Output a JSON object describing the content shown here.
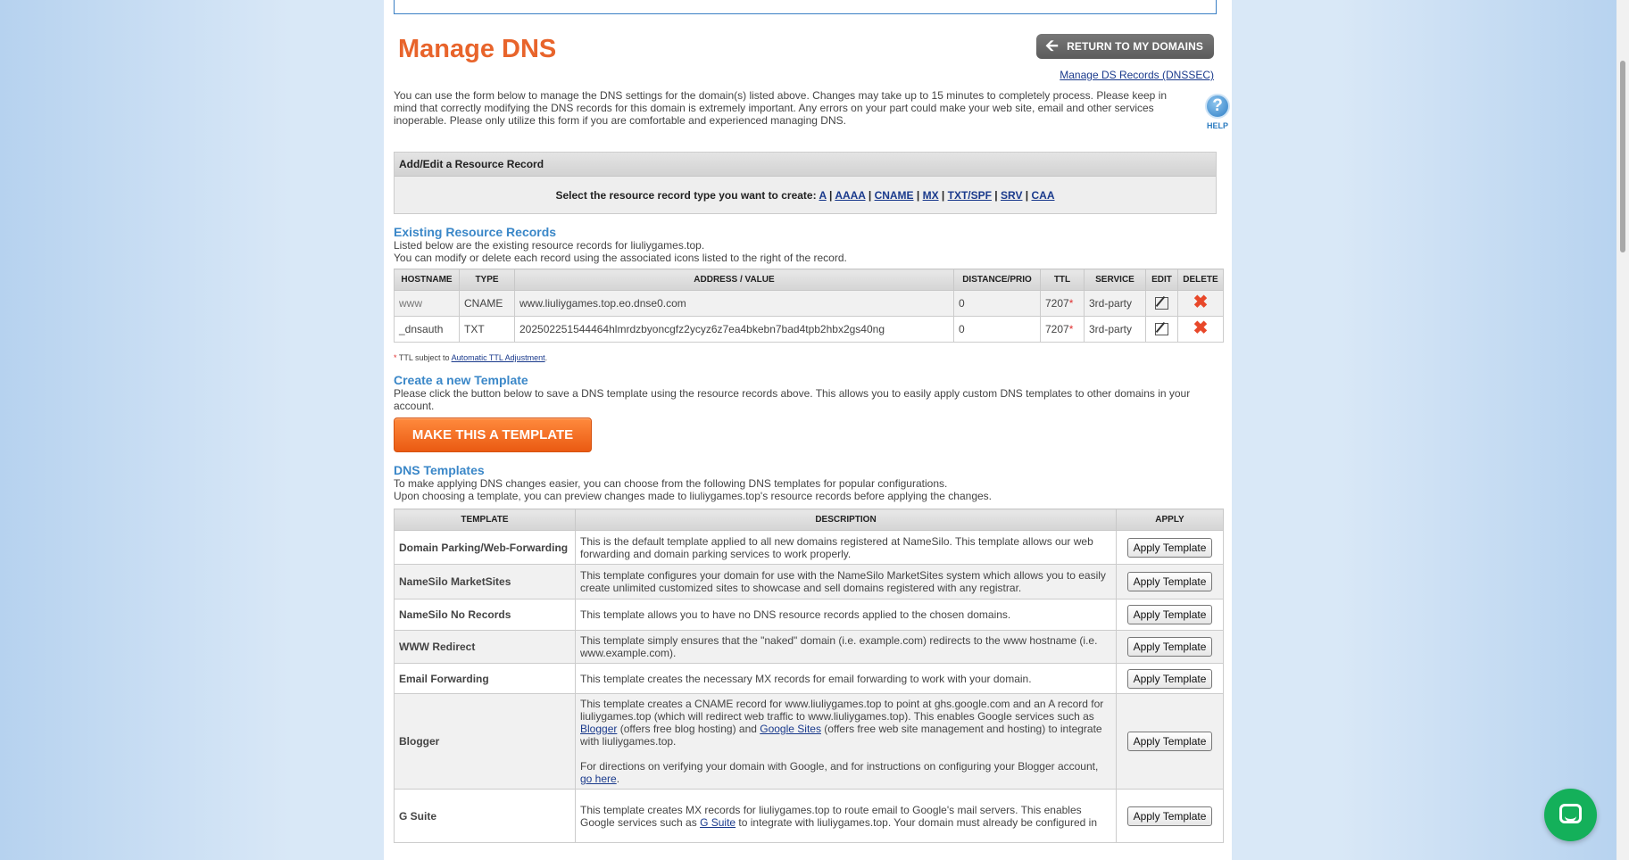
{
  "header": {
    "title": "Manage DNS",
    "return_label": "RETURN TO MY DOMAINS",
    "dnssec_link": "Manage DS Records (DNSSEC)",
    "help_label": "HELP",
    "help_glyph": "?"
  },
  "intro": "You can use the form below to manage the DNS settings for the domain(s) listed above. Changes may take up to 15 minutes to completely process. Please keep in mind that correctly modifying the DNS records for this domain is extremely important. Any errors on your part could make your web site, email and other services inoperable. Please only utilize this form if you are comfortable and experienced managing DNS.",
  "add_record": {
    "heading": "Add/Edit a Resource Record",
    "prompt": "Select the resource record type you want to create:",
    "types": [
      "A",
      "AAAA",
      "CNAME",
      "MX",
      "TXT/SPF",
      "SRV",
      "CAA"
    ]
  },
  "existing": {
    "heading": "Existing Resource Records",
    "line1": "Listed below are the existing resource records for liuliygames.top.",
    "line2": "You can modify or delete each record using the associated icons listed to the right of the record.",
    "columns": [
      "HOSTNAME",
      "TYPE",
      "ADDRESS / VALUE",
      "DISTANCE/PRIO",
      "TTL",
      "SERVICE",
      "EDIT",
      "DELETE"
    ],
    "rows": [
      {
        "hostname": "www",
        "type": "CNAME",
        "value": "www.liuliygames.top.eo.dnse0.com",
        "prio": "0",
        "ttl": "7207",
        "service": "3rd-party"
      },
      {
        "hostname": "_dnsauth",
        "type": "TXT",
        "value": "202502251544464hlmrdzbyoncgfz2ycyz6z7ea4bkebn7bad4tpb2hbx2gs40ng",
        "prio": "0",
        "ttl": "7207",
        "service": "3rd-party"
      }
    ],
    "star": "*",
    "ttl_note": "TTL subject to",
    "ttl_link": "Automatic TTL Adjustment",
    "ttl_end": "."
  },
  "create_template": {
    "heading": "Create a new Template",
    "text": "Please click the button below to save a DNS template using the resource records above. This allows you to easily apply custom DNS templates to other domains in your account.",
    "button": "MAKE THIS A TEMPLATE"
  },
  "templates": {
    "heading": "DNS Templates",
    "line1": "To make applying DNS changes easier, you can choose from the following DNS templates for popular configurations.",
    "line2": "Upon choosing a template, you can preview changes made to liuliygames.top's resource records before applying the changes.",
    "columns": [
      "TEMPLATE",
      "DESCRIPTION",
      "APPLY"
    ],
    "apply_label": "Apply Template",
    "rows": [
      {
        "name": "Domain Parking/Web-Forwarding",
        "desc": "This is the default template applied to all new domains registered at NameSilo. This template allows our web forwarding and domain parking services to work properly."
      },
      {
        "name": "NameSilo MarketSites",
        "desc": "This template configures your domain for use with the NameSilo MarketSites system which allows you to easily create unlimited customized sites to showcase and sell domains registered with any registrar."
      },
      {
        "name": "NameSilo No Records",
        "desc": "This template allows you to have no DNS resource records applied to the chosen domains."
      },
      {
        "name": "WWW Redirect",
        "desc": "This template simply ensures that the \"naked\" domain (i.e. example.com) redirects to the www hostname (i.e. www.example.com)."
      },
      {
        "name": "Email Forwarding",
        "desc": "This template creates the necessary MX records for email forwarding to work with your domain."
      }
    ],
    "blogger": {
      "name": "Blogger",
      "p1a": "This template creates a CNAME record for www.liuliygames.top to point at ghs.google.com and an A record for liuliygames.top (which will redirect web traffic to www.liuliygames.top). This enables Google services such as ",
      "link1": "Blogger",
      "p1b": " (offers free blog hosting) and ",
      "link2": "Google Sites",
      "p1c": " (offers free web site management and hosting) to integrate with liuliygames.top.",
      "p2a": "For directions on verifying your domain with Google, and for instructions on configuring your Blogger account, ",
      "link3": "go here",
      "p2b": "."
    },
    "gsuite": {
      "name": "G Suite",
      "pa": "This template creates MX records for liuliygames.top to route email to Google's mail servers. This enables Google services such as ",
      "link": "G Suite",
      "pb": " to integrate with liuliygames.top. Your domain must already be configured in"
    }
  }
}
